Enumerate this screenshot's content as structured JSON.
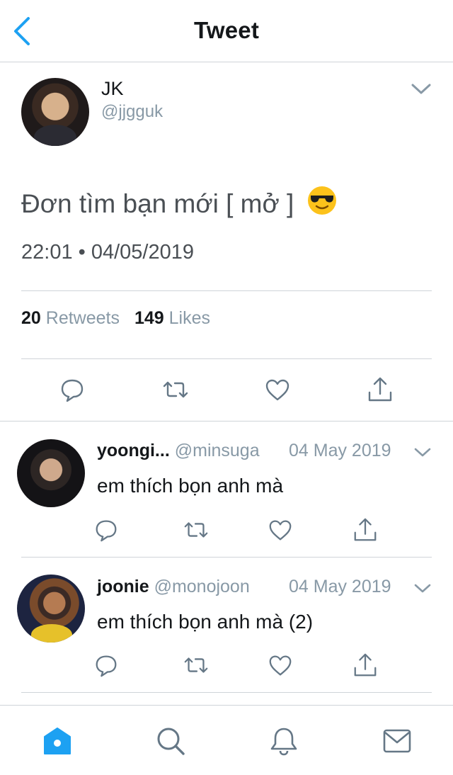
{
  "header": {
    "title": "Tweet"
  },
  "tweet": {
    "name": "JK",
    "handle": "@jjgguk",
    "text": "Đơn tìm bạn mới [ mở ]",
    "emoji": "smiling-face-with-sunglasses",
    "timestamp": "22:01 • 04/05/2019",
    "retweets_count": "20",
    "retweets_label": "Retweets",
    "likes_count": "149",
    "likes_label": "Likes"
  },
  "replies": [
    {
      "name": "yoongi...",
      "handle": "@minsuga",
      "date": "04 May 2019",
      "text": "em thích bọn anh mà"
    },
    {
      "name": "joonie",
      "handle": "@monojoon",
      "date": "04 May 2019",
      "text": "em thích bọn anh mà (2)"
    }
  ],
  "tabbar": {
    "items": [
      "home-icon",
      "search-icon",
      "notifications-icon",
      "messages-icon"
    ],
    "active": "home-icon"
  },
  "colors": {
    "accent": "#1da1f2",
    "icon": "#657786",
    "secondary_text": "#8899a6"
  }
}
